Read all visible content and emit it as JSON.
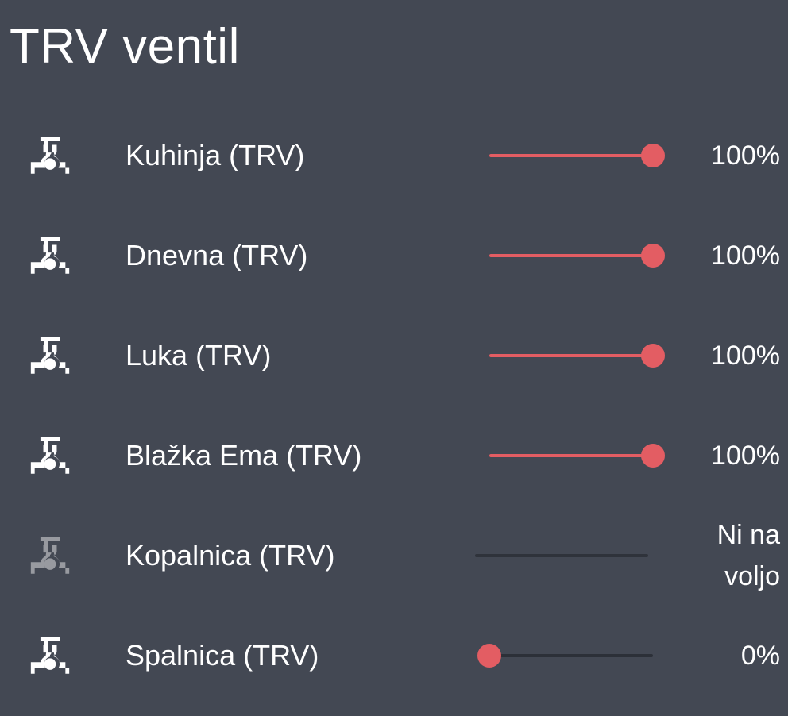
{
  "card": {
    "title": "TRV ventil"
  },
  "colors": {
    "background": "#434853",
    "accent": "#e35d63",
    "track": "#2c3038",
    "text": "#ffffff"
  },
  "rows": [
    {
      "name": "Kuhinja (TRV)",
      "icon": "valve-icon",
      "value_text": "100%",
      "level_percent": 100,
      "available": true
    },
    {
      "name": "Dnevna (TRV)",
      "icon": "valve-icon",
      "value_text": "100%",
      "level_percent": 100,
      "available": true
    },
    {
      "name": "Luka (TRV)",
      "icon": "valve-icon",
      "value_text": "100%",
      "level_percent": 100,
      "available": true
    },
    {
      "name": "Blažka Ema (TRV)",
      "icon": "valve-icon",
      "value_text": "100%",
      "level_percent": 100,
      "available": true
    },
    {
      "name": "Kopalnica (TRV)",
      "icon": "valve-icon",
      "value_text": "Ni na voljo",
      "level_percent": null,
      "available": false
    },
    {
      "name": "Spalnica (TRV)",
      "icon": "valve-icon",
      "value_text": "0%",
      "level_percent": 0,
      "available": true
    }
  ]
}
